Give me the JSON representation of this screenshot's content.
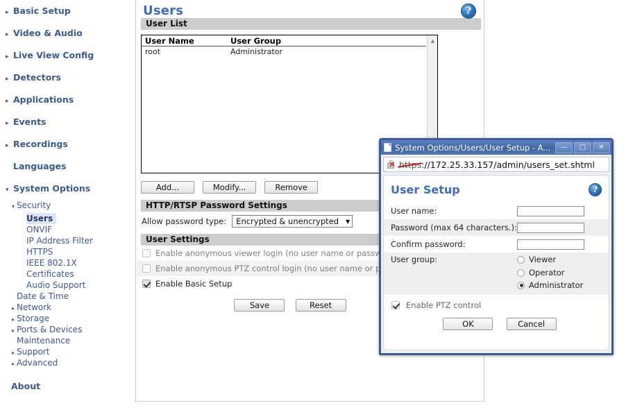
{
  "sidebar": {
    "top_items": [
      {
        "label": "Basic Setup",
        "arrow": "▸"
      },
      {
        "label": "Video & Audio",
        "arrow": "▸"
      },
      {
        "label": "Live View Config",
        "arrow": "▸"
      },
      {
        "label": "Detectors",
        "arrow": "▸"
      },
      {
        "label": "Applications",
        "arrow": "▸"
      },
      {
        "label": "Events",
        "arrow": "▸"
      },
      {
        "label": "Recordings",
        "arrow": "▸"
      },
      {
        "label": "Languages",
        "arrow": ""
      },
      {
        "label": "System Options",
        "arrow": "▾"
      }
    ],
    "system_options": {
      "security": {
        "label": "Security",
        "arrow": "▾"
      },
      "security_children": [
        "Users",
        "ONVIF",
        "IP Address Filter",
        "HTTPS",
        "IEEE 802.1X",
        "Certificates",
        "Audio Support"
      ],
      "selected_child": "Users",
      "other_children": [
        {
          "label": "Date & Time",
          "arrow": ""
        },
        {
          "label": "Network",
          "arrow": "▸"
        },
        {
          "label": "Storage",
          "arrow": "▸"
        },
        {
          "label": "Ports & Devices",
          "arrow": "▸"
        },
        {
          "label": "Maintenance",
          "arrow": ""
        },
        {
          "label": "Support",
          "arrow": "▸"
        },
        {
          "label": "Advanced",
          "arrow": "▸"
        }
      ]
    },
    "about": "About"
  },
  "main": {
    "page_title": "Users",
    "help_glyph": "?",
    "user_list": {
      "section_label": "User List",
      "columns": [
        "User Name",
        "User Group"
      ],
      "rows": [
        {
          "user_name": "root",
          "user_group": "Administrator"
        }
      ],
      "scroll_up_glyph": "▲"
    },
    "list_buttons": [
      {
        "label": "Add..."
      },
      {
        "label": "Modify..."
      },
      {
        "label": "Remove"
      }
    ],
    "password_settings": {
      "section_label": "HTTP/RTSP Password Settings",
      "field_label": "Allow password type:",
      "selected_value": "Encrypted & unencrypted",
      "caret": "▼"
    },
    "user_settings": {
      "section_label": "User Settings",
      "checkboxes": [
        {
          "label": "Enable anonymous viewer login (no user name or password required)",
          "checked": false,
          "dim": true
        },
        {
          "label": "Enable anonymous PTZ control login (no user name or password required)",
          "checked": false,
          "dim": true
        },
        {
          "label": "Enable Basic Setup",
          "checked": true,
          "dim": false
        }
      ],
      "save_label": "Save",
      "reset_label": "Reset"
    }
  },
  "dialog": {
    "titlebar": {
      "title": "System Options/Users/User Setup - A...",
      "minimize_glyph": "—",
      "restore_glyph": "□",
      "close_glyph": "✕"
    },
    "url": {
      "scheme": "https",
      "rest": "://172.25.33.157/admin/users_set.shtml"
    },
    "heading": "User Setup",
    "help_glyph": "?",
    "fields": [
      {
        "label": "User name:",
        "value": "",
        "shade": false
      },
      {
        "label": "Password (max 64 characters.):",
        "value": "",
        "shade": true
      },
      {
        "label": "Confirm password:",
        "value": "",
        "shade": false
      }
    ],
    "user_group": {
      "label": "User group:",
      "options": [
        {
          "label": "Viewer",
          "selected": false
        },
        {
          "label": "Operator",
          "selected": false
        },
        {
          "label": "Administrator",
          "selected": true
        }
      ]
    },
    "ptz": {
      "label": "Enable PTZ control",
      "checked": true
    },
    "ok_label": "OK",
    "cancel_label": "Cancel"
  }
}
